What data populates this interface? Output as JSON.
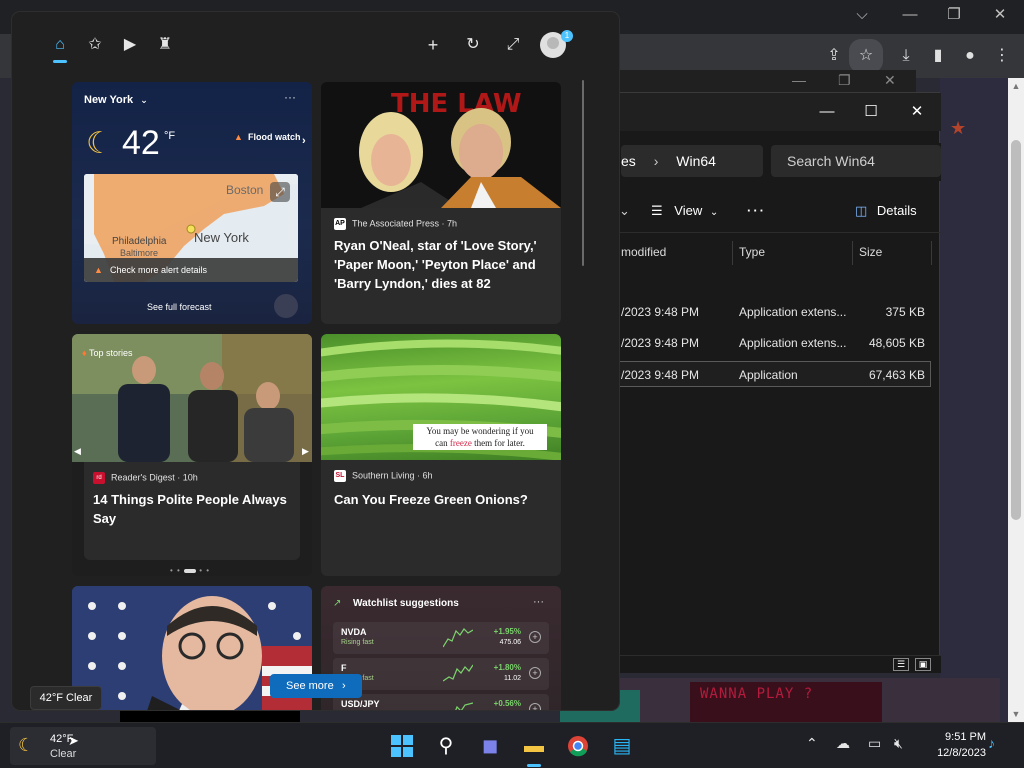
{
  "widgets": {
    "nav": {
      "home_icon": "home-icon",
      "favorites_icon": "star-plus-icon",
      "video_icon": "play-icon",
      "games_icon": "game-icon",
      "add_icon": "plus-icon",
      "refresh_icon": "refresh-icon",
      "expand_icon": "expand-icon",
      "avatar_badge": "1"
    },
    "weather": {
      "location": "New York",
      "temperature": "42",
      "unit": "°F",
      "alert": "Flood watch",
      "alert_details": "Check more alert details",
      "forecast_button": "See full forecast",
      "map_labels": [
        "Boston",
        "New York",
        "Philadelphia",
        "Baltimore"
      ]
    },
    "news1": {
      "source": "The Associated Press · 7h",
      "headline": "Ryan O'Neal, star of 'Love Story,' 'Paper Moon,' 'Peyton Place' and 'Barry Lyndon,' dies at 82"
    },
    "stories": {
      "badge": "Top stories",
      "source": "Reader's Digest · 10h",
      "headline": "14 Things Polite People Always Say"
    },
    "news2": {
      "source": "Southern Living · 6h",
      "headline": "Can You Freeze Green Onions?",
      "caption_line1": "You may be wondering if you",
      "caption_pre": "can ",
      "caption_red": "freeze",
      "caption_post": " them for later."
    },
    "stocks": {
      "header": "Watchlist suggestions",
      "rows": [
        {
          "symbol": "NVDA",
          "subtitle": "Rising fast",
          "change": "+1.95%",
          "price": "475.06"
        },
        {
          "symbol": "F",
          "subtitle": "Rising fast",
          "change": "+1.80%",
          "price": "11.02"
        },
        {
          "symbol": "USD/JPY",
          "subtitle": "",
          "change": "+0.56%",
          "price": ""
        }
      ]
    },
    "see_more": "See more"
  },
  "tooltip": "42°F Clear",
  "explorer": {
    "breadcrumb_partial": "es",
    "breadcrumb_current": "Win64",
    "search_placeholder": "Search Win64",
    "view_label": "View",
    "details_label": "Details",
    "columns": {
      "modified": "modified",
      "type": "Type",
      "size": "Size"
    },
    "rows": [
      {
        "date": "/2023 9:48 PM",
        "type": "Application extens...",
        "size": "375 KB"
      },
      {
        "date": "/2023 9:48 PM",
        "type": "Application extens...",
        "size": "48,605 KB"
      },
      {
        "date": "/2023 9:48 PM",
        "type": "Application",
        "size": "67,463 KB"
      }
    ]
  },
  "taskbar": {
    "weather_temp": "42°F",
    "weather_cond": "Clear",
    "time": "9:51 PM",
    "date": "12/8/2023"
  },
  "colors": {
    "accent": "#4cc2ff",
    "see_more": "#0f6cbd",
    "stock_up": "#7ad36c"
  }
}
